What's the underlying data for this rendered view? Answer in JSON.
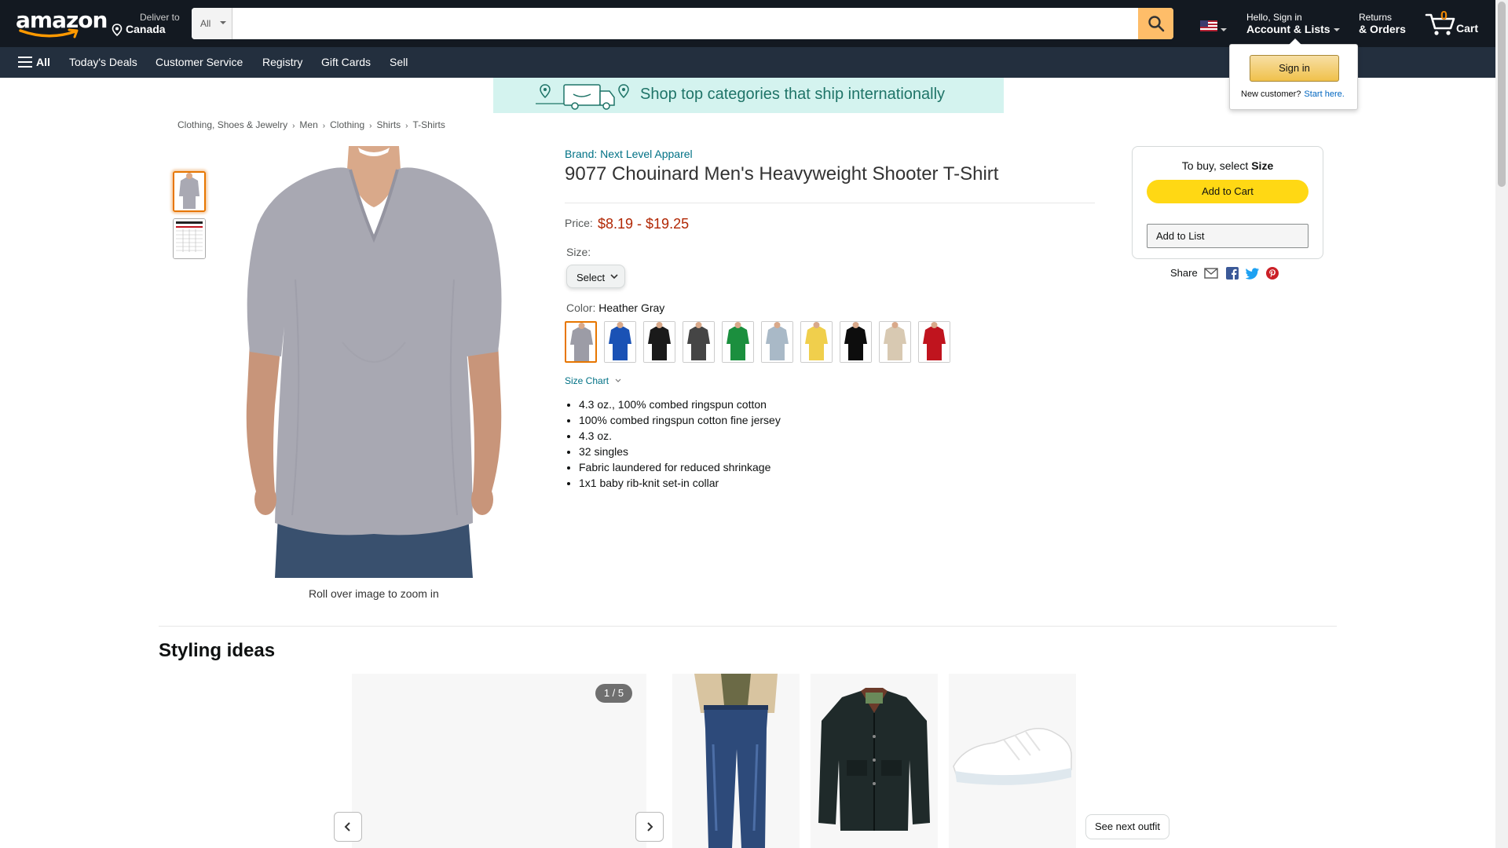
{
  "header": {
    "logo": "amazon",
    "deliver_line1": "Deliver to",
    "deliver_line2": "Canada",
    "search_category": "All",
    "search_placeholder": "",
    "account_line1": "Hello, Sign in",
    "account_line2": "Account & Lists",
    "returns_line1": "Returns",
    "returns_line2": "& Orders",
    "cart_count": "0",
    "cart_label": "Cart"
  },
  "subnav": {
    "all_label": "All",
    "items": [
      "Today's Deals",
      "Customer Service",
      "Registry",
      "Gift Cards",
      "Sell"
    ]
  },
  "signin_flyout": {
    "button": "Sign in",
    "new_customer": "New customer?",
    "start_here": "Start here."
  },
  "banner": {
    "text": "Shop top categories that ship internationally"
  },
  "breadcrumb": [
    "Clothing, Shoes & Jewelry",
    "Men",
    "Clothing",
    "Shirts",
    "T-Shirts"
  ],
  "product": {
    "brand": "Brand: Next Level Apparel",
    "title": "9077 Chouinard Men's Heavyweight Shooter T-Shirt",
    "price_label": "Price:",
    "price": "$8.19 - $19.25",
    "size_label": "Size:",
    "size_value": "Select",
    "color_label": "Color:",
    "color_value": "Heather Gray",
    "size_chart": "Size Chart",
    "zoom_hint": "Roll over image to zoom in",
    "bullets": [
      "4.3 oz., 100% combed ringspun cotton",
      "100% combed ringspun cotton fine jersey",
      "4.3 oz.",
      "32 singles",
      "Fabric laundered for reduced shrinkage",
      "1x1 baby rib-knit set-in collar"
    ],
    "swatch_colors": [
      "#9c9ca6",
      "#1a52b5",
      "#1a1a1a",
      "#454545",
      "#1b8f3e",
      "#a9b9c7",
      "#f0cf4c",
      "#0d0d0d",
      "#d8c9b2",
      "#c0141e"
    ]
  },
  "buybox": {
    "to_buy_prefix": "To buy, select",
    "to_buy_bold": "Size",
    "add_to_cart": "Add to Cart",
    "add_to_list": "Add to List",
    "share_label": "Share"
  },
  "styling": {
    "heading": "Styling ideas",
    "counter": "1 / 5",
    "see_next": "See next outfit"
  }
}
